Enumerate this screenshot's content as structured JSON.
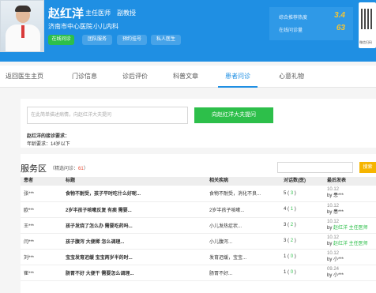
{
  "header": {
    "name": "赵红洋",
    "title1": "主任医师",
    "title2": "副教授",
    "hospital": "济南市中心医院",
    "department": "小儿内科",
    "buttons": [
      "在线问诊",
      "团队服务",
      "预约挂号",
      "私人医生"
    ],
    "stats": [
      {
        "label": "综合推荐热度",
        "value": "3.4"
      },
      {
        "label": "在线问诊量",
        "value": "63"
      }
    ],
    "qr_caption": "微信扫码"
  },
  "tabs": [
    "返回医生主页",
    "门诊信息",
    "诊后评价",
    "科普文章",
    "患者问诊",
    "心意礼物"
  ],
  "active_tab": 4,
  "ask": {
    "placeholder": "在此简单描述病情，向赵红洋大夫提问",
    "button": "向赵红洋大夫提问",
    "requirement_title": "赵红洋的接诊要求：",
    "requirement_age": "年龄要求：14岁以下"
  },
  "service": {
    "title": "服务区",
    "count_prefix": "（精选问诊：",
    "count_value": "61",
    "count_suffix": "）",
    "search_button": "搜索"
  },
  "table": {
    "headers": [
      "患者",
      "标题",
      "相关疾病",
      "对话数(医)",
      "最后发表"
    ],
    "rows": [
      {
        "patient": "张***",
        "title": "食物不耐受，孩子平时吃什么好呢...",
        "disease": "食物不耐受，消化不良...",
        "count": "5",
        "count_doc": "3",
        "date": "10.12",
        "by_prefix": "by ",
        "by_name": "患***",
        "by_is_doctor": false
      },
      {
        "patient": "欧***",
        "title": "2岁半孩子咳嗽反复 有痰 需要...",
        "disease": "2岁半孩子咳嗽...",
        "count": "4",
        "count_doc": "1",
        "date": "10.12",
        "by_prefix": "by ",
        "by_name": "患***",
        "by_is_doctor": false
      },
      {
        "patient": "王***",
        "title": "孩子发烧了怎么办 需要吃药吗...",
        "disease": "小儿发热症状...",
        "count": "3",
        "count_doc": "2",
        "date": "10.12",
        "by_prefix": "by ",
        "by_name": "赵红洋 主任医师",
        "by_is_doctor": true
      },
      {
        "patient": "闫***",
        "title": "孩子腹泻 大便稀 怎么调理...",
        "disease": "小儿腹泻...",
        "count": "3",
        "count_doc": "2",
        "date": "10.12",
        "by_prefix": "by ",
        "by_name": "赵红洋 主任医师",
        "by_is_doctor": true
      },
      {
        "patient": "刘***",
        "title": "宝宝发育迟缓 宝宝两岁半的时...",
        "disease": "发育迟缓，宝宝...",
        "count": "1",
        "count_doc": "0",
        "date": "10.12",
        "by_prefix": "by ",
        "by_name": "小***",
        "by_is_doctor": false
      },
      {
        "patient": "崔***",
        "title": "肠胃不好 大便干 需要怎么调理...",
        "disease": "肠胃不好...",
        "count": "1",
        "count_doc": "0",
        "date": "09.24",
        "by_prefix": "by ",
        "by_name": "小***",
        "by_is_doctor": false
      }
    ]
  },
  "colors": {
    "header_blue": "#1f8fe3",
    "green": "#2dbf4a",
    "orange": "#f6b500",
    "stat_yellow": "#f7c531"
  }
}
